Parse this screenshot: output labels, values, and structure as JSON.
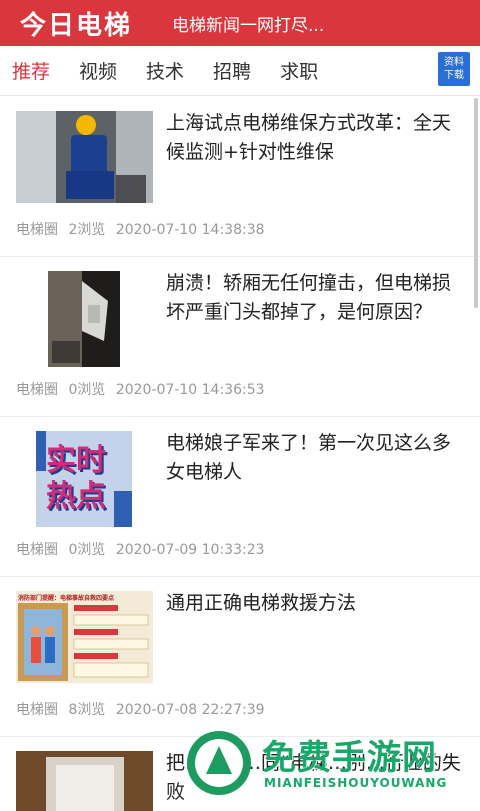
{
  "header": {
    "app_title": "今日电梯",
    "ticker": "电梯新闻一网打尽..."
  },
  "tabs": [
    {
      "label": "推荐",
      "active": true
    },
    {
      "label": "视频",
      "active": false
    },
    {
      "label": "技术",
      "active": false
    },
    {
      "label": "招聘",
      "active": false
    },
    {
      "label": "求职",
      "active": false
    }
  ],
  "download_badge": {
    "line1": "资料",
    "line2": "下载"
  },
  "articles": [
    {
      "title": "上海试点电梯维保方式改革：全天候监测+针对性维保",
      "source": "电梯圈",
      "views": "2浏览",
      "time": "2020-07-10 14:38:38"
    },
    {
      "title": "崩溃！轿厢无任何撞击，但电梯损坏严重门头都掉了，是何原因？",
      "source": "电梯圈",
      "views": "0浏览",
      "time": "2020-07-10 14:36:53"
    },
    {
      "title": "电梯娘子军来了！第一次见这么多女电梯人",
      "source": "电梯圈",
      "views": "0浏览",
      "time": "2020-07-09 10:33:23",
      "thumb_text": [
        "实时",
        "热点"
      ]
    },
    {
      "title": "通用正确电梯救援方法",
      "source": "电梯圈",
      "views": "8浏览",
      "time": "2020-07-08 22:27:39",
      "thumb_text": [
        "消防部门提醒：电梯事故自救四要点"
      ]
    },
    {
      "title": "把…电梯…同“电梯…别…行业的失败",
      "source": "",
      "views": "",
      "time": ""
    }
  ],
  "watermark": {
    "text": "免费手游网",
    "sub": "MIANFEISHOUYOUWANG"
  },
  "colors": {
    "brand": "#d9363e",
    "badge": "#2a6fd6",
    "watermark": "#19a76a"
  }
}
